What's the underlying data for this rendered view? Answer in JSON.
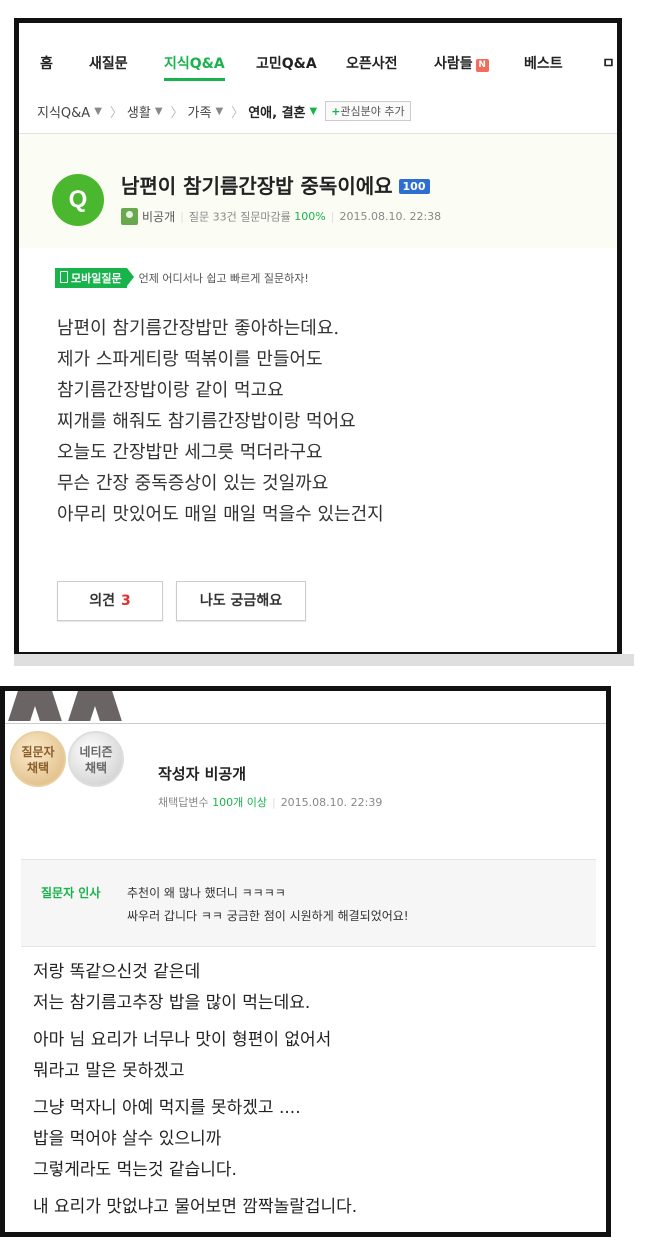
{
  "question_panel": {
    "nav": {
      "items": [
        {
          "label": "홈"
        },
        {
          "label": "새질문"
        },
        {
          "label": "지식Q&A",
          "active": true
        },
        {
          "label": "고민Q&A"
        },
        {
          "label": "오픈사전"
        },
        {
          "label": "사람들",
          "badge": "N"
        },
        {
          "label": "베스트"
        },
        {
          "label": "ㅁ"
        }
      ]
    },
    "breadcrumb": {
      "items": [
        "지식Q&A",
        "생활",
        "가족"
      ],
      "current": "연애, 결혼",
      "add_interest": "관심분야 추가"
    },
    "question": {
      "icon_letter": "Q",
      "title": "남편이 참기름간장밥 중독이에요",
      "score": "100",
      "author": "비공개",
      "stats_label": "질문 33건 질문마감률",
      "close_rate": "100%",
      "date": "2015.08.10. 22:38"
    },
    "mobile": {
      "tag": "모바일질문",
      "text": "언제 어디서나 쉽고 빠르게 질문하자!"
    },
    "body_lines": [
      "남편이 참기름간장밥만 좋아하는데요.",
      "제가 스파게티랑 떡볶이를 만들어도",
      "참기름간장밥이랑 같이 먹고요",
      "찌개를 해줘도 참기름간장밥이랑 먹어요",
      "오늘도 간장밥만 세그릇 먹더라구요",
      "무슨 간장 중독증상이 있는 것일까요",
      "아무리 맛있어도 매일 매일 먹을수 있는건지"
    ],
    "actions": {
      "opinion_label": "의견",
      "opinion_count": "3",
      "curious_label": "나도 궁금해요"
    }
  },
  "answer_panel": {
    "medals": [
      {
        "line1": "질문자",
        "line2": "채택"
      },
      {
        "line1": "네티즌",
        "line2": "채택"
      }
    ],
    "author": {
      "name": "작성자 비공개",
      "meta_label": "채택답변수",
      "meta_value": "100개 이상",
      "date": "2015.08.10. 22:39"
    },
    "greeting": {
      "label": "질문자 인사",
      "line1": "추천이 왜 많나 했더니 ㅋㅋㅋㅋ",
      "line2": "싸우러 갑니다 ㅋㅋ   궁금한 점이 시원하게 해결되었어요!"
    },
    "body_lines": [
      "저랑 똑같으신것 같은데",
      "저는 참기름고추장 밥을 많이 먹는데요.",
      "아마 님 요리가 너무나 맛이 형편이 없어서",
      "뭐라고 말은 못하겠고",
      "그냥 먹자니 아예 먹지를 못하겠고 ....",
      "밥을 먹어야 살수 있으니까",
      "그렇게라도 먹는것 같습니다.",
      "내 요리가 맛없냐고 물어보면 깜짝놀랄겁니다."
    ]
  },
  "colors": {
    "accent_green": "#19b34b",
    "q_circle": "#4ab72f",
    "score_badge": "#2d6fd1",
    "opinion_count": "#e03131",
    "n_badge": "#f26b5b"
  }
}
